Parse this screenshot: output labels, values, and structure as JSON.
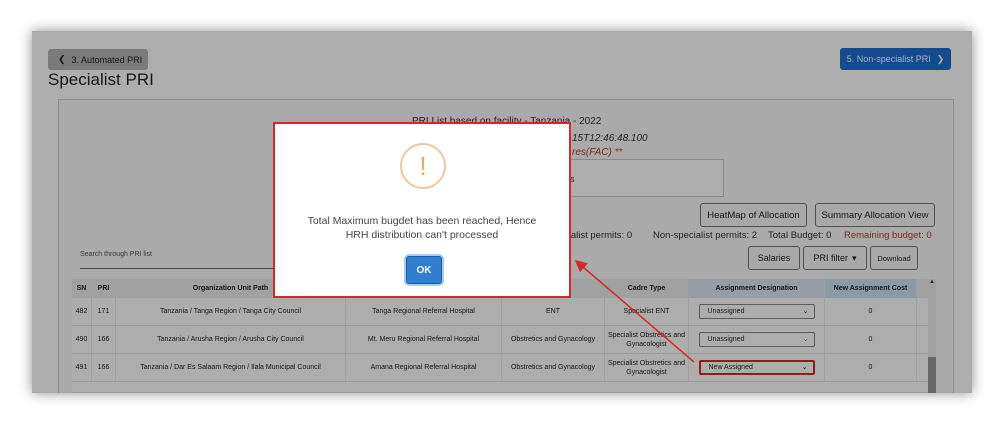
{
  "nav": {
    "prev_label": "3. Automated PRI",
    "next_label": "5. Non-specialist PRI",
    "page_title": "Specialist PRI"
  },
  "info": {
    "line1": "PRI List based on facility - Tanzania - 2022",
    "line2": "15T12:46:48.100",
    "line3": "res(FAC) **",
    "line4": "es"
  },
  "buttons": {
    "heatmap": "HeatMap of Allocation",
    "summary": "Summary Allocation View",
    "salaries": "Salaries",
    "pri_filter": "PRI filter",
    "download": "Download"
  },
  "stats": {
    "specialist": "cialist permits: 0",
    "non_specialist": "Non-specialist permits: 2",
    "total_budget": "Total Budget: 0",
    "remaining_budget": "Remaining budget: 0"
  },
  "search": {
    "placeholder": "Search through PRI list"
  },
  "table": {
    "headers": {
      "sn": "SN",
      "pri": "PRI",
      "org": "Organization Unit Path",
      "facility": "",
      "category": "",
      "cadre": "Cadre Type",
      "assign": "Assignment Designation",
      "cost": "New Assignment Cost"
    },
    "rows": [
      {
        "sn": "482",
        "pri": "171",
        "org": "Tanzania / Tanga Region / Tanga City Council",
        "facility": "Tanga Regional Referral Hospital",
        "category": "ENT",
        "cadre": "Specialist ENT",
        "assign": "Unassigned",
        "cost": "0"
      },
      {
        "sn": "490",
        "pri": "166",
        "org": "Tanzania / Arusha Region / Arusha City Council",
        "facility": "Mt. Meru Regional Referral Hospital",
        "category": "Obstretics and Gynacology",
        "cadre": "Specialist Obstretics and Gynacologist",
        "assign": "Unassigned",
        "cost": "0"
      },
      {
        "sn": "491",
        "pri": "166",
        "org": "Tanzania / Dar Es Salaam Region / Ilala Municipal Council",
        "facility": "Amana Regional Referral Hospital",
        "category": "Obstretics and Gynacology",
        "cadre": "Specialist Obstretics and Gynacologist",
        "assign": "New Assigned",
        "cost": "0"
      }
    ]
  },
  "modal": {
    "icon": "warning-icon",
    "message_line1": "Total Maximum bugdet has been reached, Hence",
    "message_line2": "HRH distribution can't processed",
    "ok_label": "OK"
  },
  "colors": {
    "primary": "#1f6fd1",
    "highlight_red": "#d62828",
    "remaining_red": "#c0392b",
    "warning_orange": "#f0a868"
  }
}
